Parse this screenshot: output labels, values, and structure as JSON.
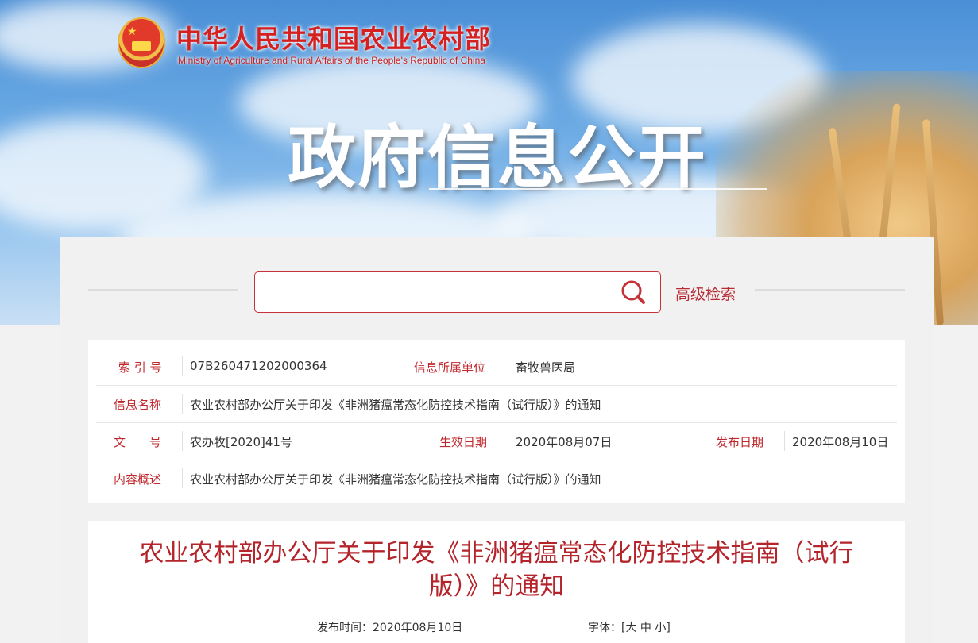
{
  "header": {
    "title_cn": "中华人民共和国农业农村部",
    "title_en": "Ministry of Agriculture and Rural Affairs of the People's Republic of China",
    "hero_title": "政府信息公开"
  },
  "search": {
    "placeholder": "",
    "advanced_label": "高级检索"
  },
  "info": {
    "index_label": "索 引 号",
    "index_value": "07B260471202000364",
    "unit_label": "信息所属单位",
    "unit_value": "畜牧兽医局",
    "name_label": "信息名称",
    "name_value": "农业农村部办公厅关于印发《非洲猪瘟常态化防控技术指南（试行版）》的通知",
    "doc_no_label": "文　　号",
    "doc_no_value": "农办牧[2020]41号",
    "effective_label": "生效日期",
    "effective_value": "2020年08月07日",
    "publish_label": "发布日期",
    "publish_value": "2020年08月10日",
    "summary_label": "内容概述",
    "summary_value": "农业农村部办公厅关于印发《非洲猪瘟常态化防控技术指南（试行版）》的通知"
  },
  "article": {
    "title_line1": "农业农村部办公厅关于印发《非洲猪瘟常态化防控技术指南（试行",
    "title_line2": "版）》的通知",
    "publish_time": "发布时间：2020年08月10日",
    "font_label": "字体：[",
    "font_large": "大",
    "font_medium": "中",
    "font_small": "小",
    "font_close": "]"
  },
  "colors": {
    "accent": "#c0282e",
    "brand_red": "#d6201f"
  }
}
